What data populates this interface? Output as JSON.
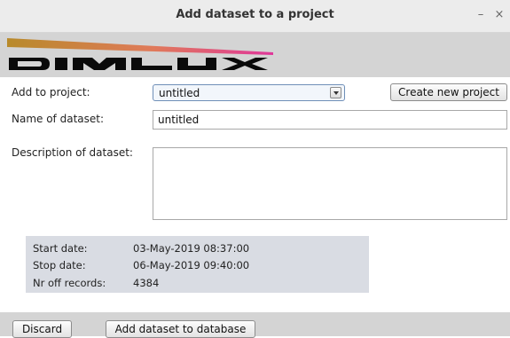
{
  "window": {
    "title": "Add dataset to a project",
    "minimize_glyph": "–",
    "close_glyph": "×"
  },
  "banner": {
    "logo_text": "DIMLUX",
    "colors": {
      "background": "#d4d4d4",
      "logo": "#0a0a0a",
      "stripe_start": "#b88a2a",
      "stripe_end": "#e0369a"
    }
  },
  "form": {
    "project_label": "Add to project:",
    "project_selected": "untitled",
    "create_project_button": "Create new project",
    "name_label": "Name of dataset:",
    "name_value": "untitled",
    "description_label": "Description of dataset:",
    "description_value": ""
  },
  "info": {
    "start_label": "Start date:",
    "start_value": "03-May-2019 08:37:00",
    "stop_label": "Stop date:",
    "stop_value": "06-May-2019 09:40:00",
    "records_label": "Nr off records:",
    "records_value": "4384"
  },
  "footer": {
    "discard_button": "Discard",
    "add_button": "Add dataset to database"
  },
  "icons": {
    "combo_arrow": "chevron-down-icon"
  }
}
